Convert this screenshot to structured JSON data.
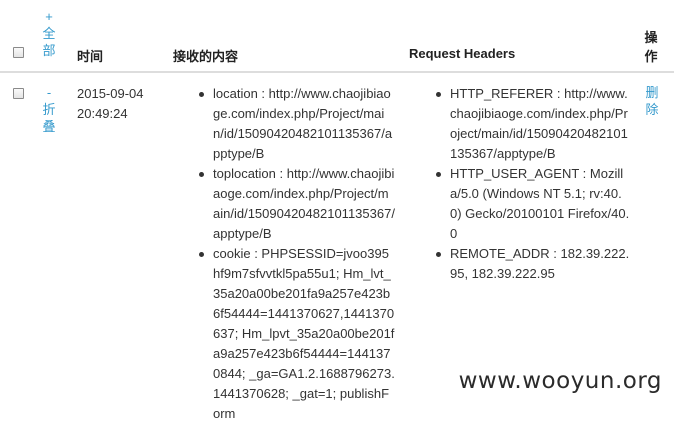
{
  "header": {
    "expand_all_label": "+ 全 部",
    "time_label": "时间",
    "content_label": "接收的内容",
    "request_headers_label": "Request Headers",
    "actions_label": "操作"
  },
  "row": {
    "toggle_label": "- 折 叠",
    "time": "2015-09-04 20:49:24",
    "content_items": [
      "location : http://www.chaojibiaoge.com/index.php/Project/main/id/15090420482101135367/apptype/B",
      "toplocation : http://www.chaojibiaoge.com/index.php/Project/main/id/15090420482101135367/apptype/B",
      "cookie : PHPSESSID=jvoo395hf9m7sfvvtkl5pa55u1; Hm_lvt_35a20a00be201fa9a257e423b6f54444=1441370627,1441370637; Hm_lpvt_35a20a00be201fa9a257e423b6f54444=1441370844; _ga=GA1.2.1688796273.1441370628; _gat=1; publishForm"
    ],
    "header_items": [
      "HTTP_REFERER : http://www.chaojibiaoge.com/index.php/Project/main/id/15090420482101135367/apptype/B",
      "HTTP_USER_AGENT : Mozilla/5.0 (Windows NT 5.1; rv:40.0) Gecko/20100101 Firefox/40.0",
      "REMOTE_ADDR : 182.39.222.95, 182.39.222.95"
    ],
    "delete_label": "删 除"
  },
  "watermark": "www.wooyun.org",
  "colors": {
    "link": "#3399cc",
    "border": "#dddddd",
    "text": "#333333"
  }
}
